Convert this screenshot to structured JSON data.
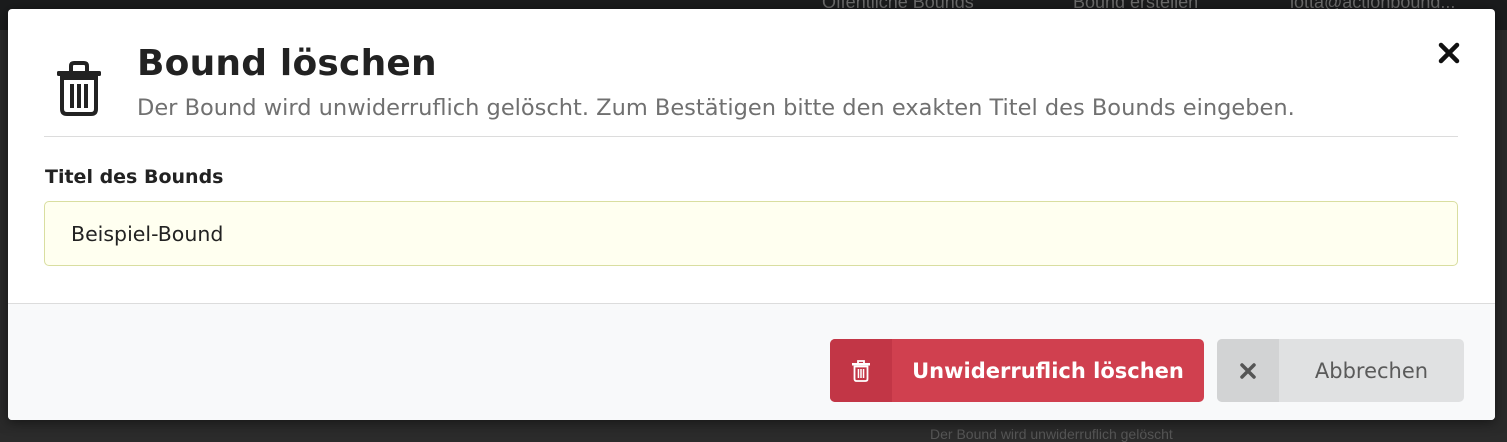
{
  "background": {
    "topbar_links": [
      "Öffentliche Bounds",
      "Bound erstellen",
      "lotta@actionbound..."
    ],
    "bottom_text": "Der Bound wird unwiderruflich gelöscht"
  },
  "modal": {
    "header": {
      "icon": "trash-icon",
      "title": "Bound löschen",
      "subtitle": "Der Bound wird unwiderruflich gelöscht. Zum Bestätigen bitte den exakten Titel des Bounds eingeben.",
      "close_icon": "close-icon"
    },
    "form": {
      "title_label": "Titel des Bounds",
      "title_value": "Beispiel-Bound"
    },
    "footer": {
      "delete_button": {
        "icon": "trash-icon",
        "label": "Unwiderruflich löschen"
      },
      "cancel_button": {
        "icon": "close-icon",
        "label": "Abbrechen"
      }
    }
  },
  "colors": {
    "danger": "#d0404f",
    "danger_icon_bg": "#c23646",
    "cancel": "#e0e1e2",
    "input_bg": "#fffff0",
    "input_border": "#d9dea0",
    "footer_bg": "#f8f9fa"
  }
}
